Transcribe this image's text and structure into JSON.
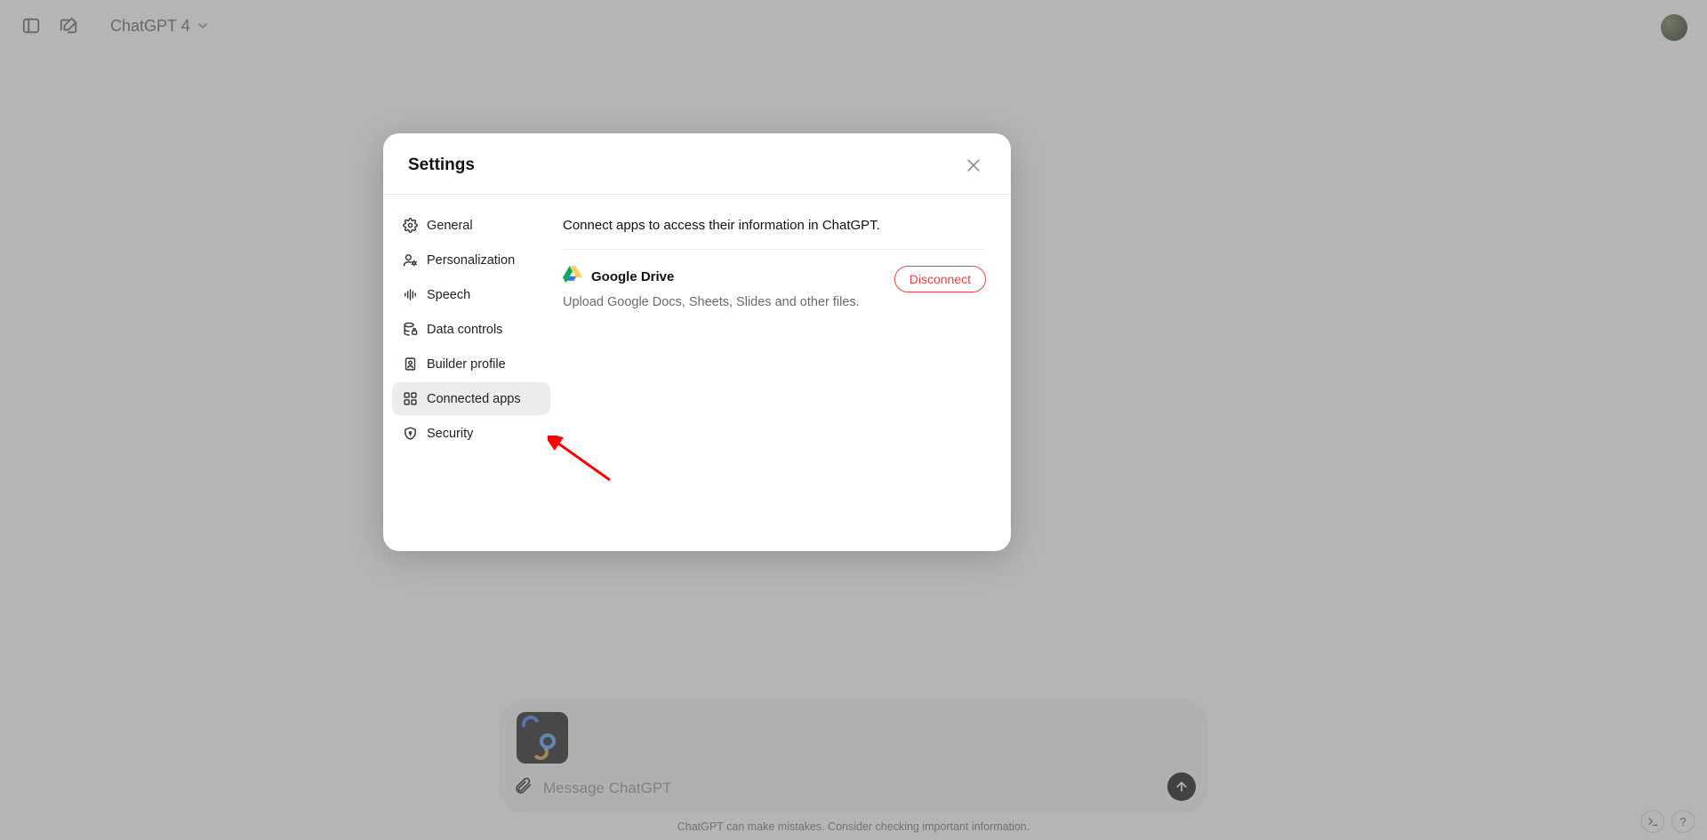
{
  "topbar": {
    "model_label": "ChatGPT 4"
  },
  "composer": {
    "placeholder": "Message ChatGPT"
  },
  "footnote": "ChatGPT can make mistakes. Consider checking important information.",
  "modal": {
    "title": "Settings",
    "nav": [
      {
        "id": "general",
        "label": "General"
      },
      {
        "id": "personalization",
        "label": "Personalization"
      },
      {
        "id": "speech",
        "label": "Speech"
      },
      {
        "id": "data-controls",
        "label": "Data controls"
      },
      {
        "id": "builder-profile",
        "label": "Builder profile"
      },
      {
        "id": "connected-apps",
        "label": "Connected apps"
      },
      {
        "id": "security",
        "label": "Security"
      }
    ],
    "active_nav": "connected-apps",
    "content": {
      "description": "Connect apps to access their information in ChatGPT.",
      "apps": [
        {
          "name": "Google Drive",
          "subtitle": "Upload Google Docs, Sheets, Slides and other files.",
          "action_label": "Disconnect"
        }
      ]
    }
  },
  "help_glyph": "?"
}
